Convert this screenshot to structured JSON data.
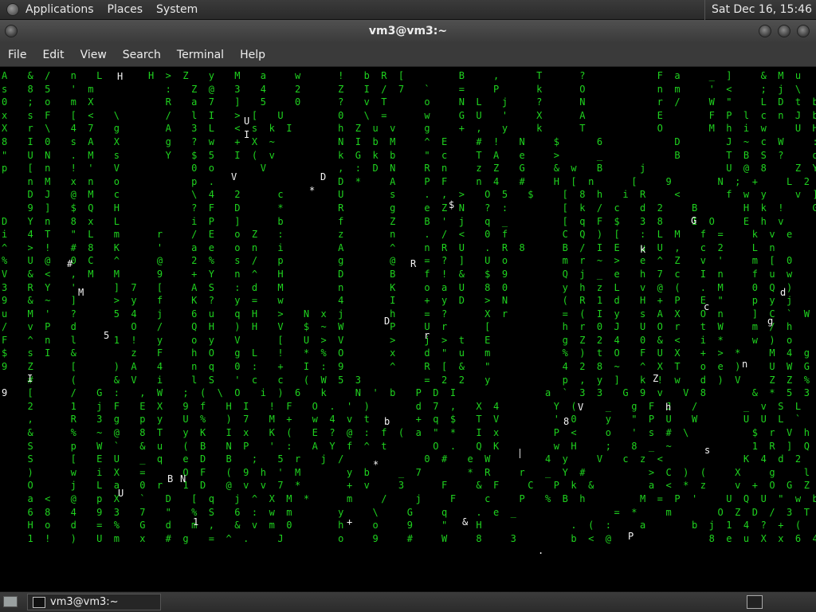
{
  "top_panel": {
    "menus": [
      "Applications",
      "Places",
      "System"
    ],
    "clock": "Sat Dec 16, 15:46"
  },
  "window": {
    "title": "vm3@vm3:~"
  },
  "menubar": [
    "File",
    "Edit",
    "View",
    "Search",
    "Terminal",
    "Help"
  ],
  "terminal": {
    "lines": [
      "A  & /  n  L     H > Z  y  M  a   w    !  b R [      B   ,    T    ?        F a   _ ]   & M u     y   = K 9 L",
      "s  8 5  ' m        :  Z @  3  4   2    Z  I / 7  `   =   P    k    O        n m   ' <   ; j \\     9   t Z 4 1",
      "0  ; o  m X        R  a 7  ]  5   0    ?  v T    o   N L  j   ?    N        r /   W \"   L D t b   8   T Z [ B",
      "x  s F  [ <  \\     /  l I  > [  U      0  \\ =    w   G U  '   X    A        E     F P l c n J b   u   e > ; 9",
      "X  r \\  4 7  g     A  3 L  < s k I     h Z u v   g   + ,  y   k    T        O     M h i w   U H   j   7 ! ' \"",
      "8  I 0  s A  X     g  ? w  + X ~       N I b M   ^ E   # !  N   $    6        D     J ~ c W   : Q   \"   7 + N R",
      "\"  U N  . M  s     Y  $ 5  I ( v       k G k b   \" c   T A  e   >    _        B     T B S ?   q <   ^   C D j a",
      "p  [ n  ! '  V        0 o     V        , : D N   R n   z Z  G   & w  B    j         U @ 8   Z Y   K   a 6 V Y",
      "   n M  x n  o        p .              D *   A   P F   n 4  #   H [ n    [   9     N ; +   L 2 `   :   ] @ k U",
      "   D J  @ M  c        \\ 4  2    c      U     s   . , >  O 5  $   [ 8 h  i R   <     f w y   v ] 0 a ]   S P k",
      "   9 ]  $ Q  H        ? F  D    *      R     g   e Z N  ? :      [ k / c  d 2   B     H k !   G w 0 4 .   e E a",
      "D  Y n  8 x  L        i P  ]    b      f     Z   B ' j  q _      [ q F $  3 8   I O   E h v     \\ b R #   3 p $",
      "i  4 T  \" L  m    r   / E  o Z  :      z     n   . / <  0 f      C Q ) [  : L M  f =   k v e     Y K x >   a q Q",
      "^  > !  # 8  K    '   a e  o n  i      A     ^   n R U  . R 8    B / I E  u U ,  c 2   L n       c = ^ 8   F V e",
      "%  U @  0 C  ^    @   2 %  s /  p      g     @   = ? ]  U o      m r ~ >  e ^ Z  v '   m [ 0     ~ x 0 Q ; 5 n c",
      "V  & <  , M  M    9   + Y  n ^  H      D     B   f ! &  $ 9      Q j _ e  h 7 c  I n   f u w     z B , ' H ' d",
      "3  R Y  '    ] 7  [   A S  : d  M      n     K   o a U  8 0      y h z L  v @ (  . M   0 Q )     c V * s = 9 3",
      "9  & ~  ]    > y  f   K ?  y =  w      4     I   + y D  > N      ( R 1 d  H + P  E \"   p y j     : ' 7 % g",
      "u  M '  ?    5 4  j   6 u  q H  >  N x j     h   = ?    X r      = ( I y  s A X  O n   ] C ` W   $ f 4",
      "/  v P  d      O  /   Q H  ) H  V  $ ~ W     P   U r    [        h r 0 J  U O r  t W   m / h   p 5   5 y ]",
      "F  ^ n  l    1 !  y   o y  V    [  U > V     >   j > t  E        g Z 2 4  0 & <  i *   w ) o   x o   / n g",
      "$  s I  &      z  F   h O  g L  !  * % O     x   d \" u  m        % ) t O  F U X  + > *   M 4 g   Z N   c E",
      "9  Z    [    ) A  4   n q  0 :  +  I : 9     ^   R [ &  \"        4 2 8 ~  ^ X T  o e )   U W G   6   q N   x",
      "   #    (    & V  i   l S  ' c  c  ( W 5 3       = 2 2  y        p , y ]  k ! w  d ) V   Z Z %   h   i e   S",
      "   [    /  G :  , W  ; ( \\ O  i ) 6  k   N ' b  P D I          a ` 3 3  G 9 v  V 8     & * 5 3       X >   t",
      "   2    1  j F  E X  9 f  H I  ! F  O . ' )     d 7 ,  X 4      Y (   _  g F J  /     _ v S L       G j   q",
      "   ,    R  3 g  p y  U %  ) 7  M +  w 4 v t     + q $  T V      ' 0   y  \" P U  W     U U L `       s ( :   ?",
      "   &    %  ~ @  8 T  y K  I x  K (  E ? @ : f ( a \" *  I x      P <   o  ' s # \\       $ r V h       K   3 c",
      "   S    p  W `  & u  ( B  N P  ' :  A Y f ^ t     O .  Q K      w H   ;  8 _ ~         1 R ] Q       <   J r",
      "   S    [  E U  _ q  e D  B  ;  5 r  j /         0 #  e W      4 y   V  c z <         K 4 d 2       >   x k # #",
      "   )    w  i X  =    O F  ( 9 h ' M     y b   _ 7     * R   r  _ Y #       > C ) (   X   g   l s ; \\",
      "   O    j  L a  0 r  1 D  @ v v 7 *     + v   3    F   & F   C  P k &      a < * z   v + O G Z ;",
      "   a <  @  p X  `  D  [ q  j ^ X M *    m   /   j   F   c   P  % B h      M = P '   U Q U \" w b N",
      "   6 8  4  9 3  7  \"  % S  6 : w m     y   \\   G   q   . e _           = *   m     O Z D / 3 T",
      "   H o  d  = %  G  d  m ,  & v m 0     h   o   9   \"   H          . ( :   a     b j 1 4 ? + (",
      "   1 !  )  U m  x  # g  = ^ .   J      o   9   #   W   8   3      b < @           8 e u X x 6 4"
    ],
    "heads": [
      "H",
      "U",
      "I",
      "V",
      "D",
      "*",
      "$",
      "G",
      "k",
      "R",
      "d",
      "M",
      "#",
      "c",
      "g",
      "D",
      "r",
      "5",
      "n",
      "I",
      "Z",
      "9",
      "V",
      "h",
      "b",
      "8",
      "s",
      "*",
      "B",
      "N",
      "U",
      "1",
      "+",
      "P",
      "&",
      "."
    ]
  },
  "bottom_panel": {
    "task_label": "vm3@vm3:~"
  }
}
